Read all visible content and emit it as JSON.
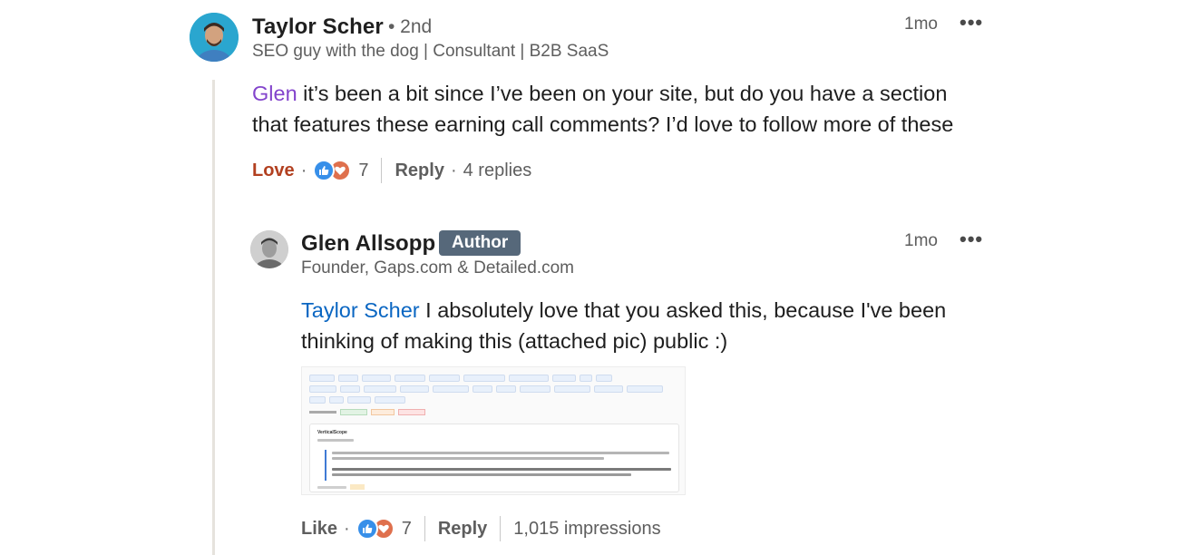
{
  "thread": {
    "comment": {
      "author": "Taylor Scher",
      "degree": "• 2nd",
      "headline": "SEO guy with the dog | Consultant | B2B SaaS",
      "time": "1mo",
      "more_label": "•••",
      "mention": "Glen",
      "text_line1": " it’s been a bit since I’ve been on your site, but do you have a section",
      "text_line2": "that features these earning call comments? I’d love to follow more of these",
      "action_reaction": "Love",
      "reaction_count": "7",
      "reply_label": "Reply",
      "replies_label": "4 replies"
    },
    "reply": {
      "author": "Glen Allsopp",
      "badge": "Author",
      "headline": "Founder, Gaps.com & Detailed.com",
      "time": "1mo",
      "more_label": "•••",
      "mention": "Taylor Scher",
      "text_line1": " I absolutely love that you asked this, because I've been",
      "text_line2": "thinking of making this (attached pic) public :)",
      "action_reaction": "Like",
      "reaction_count": "7",
      "reply_label": "Reply",
      "impressions_label": "1,015 impressions",
      "attachment": {
        "card_title": "VerticalScope",
        "filter_label": "Filter by sentiment:",
        "filter_positive": "Positive (10)",
        "filter_neutral": "Neutral (7)",
        "filter_negative": "Negative (15)"
      }
    }
  },
  "colors": {
    "love": "#b24020",
    "mention_purple": "#8344cc",
    "mention_blue": "#0a66c2",
    "badge_bg": "#56687a",
    "like_reaction": "#378fe9",
    "love_reaction": "#df704d"
  },
  "icons": [
    "more-options-icon",
    "like-reaction-icon",
    "love-reaction-icon",
    "avatar"
  ]
}
